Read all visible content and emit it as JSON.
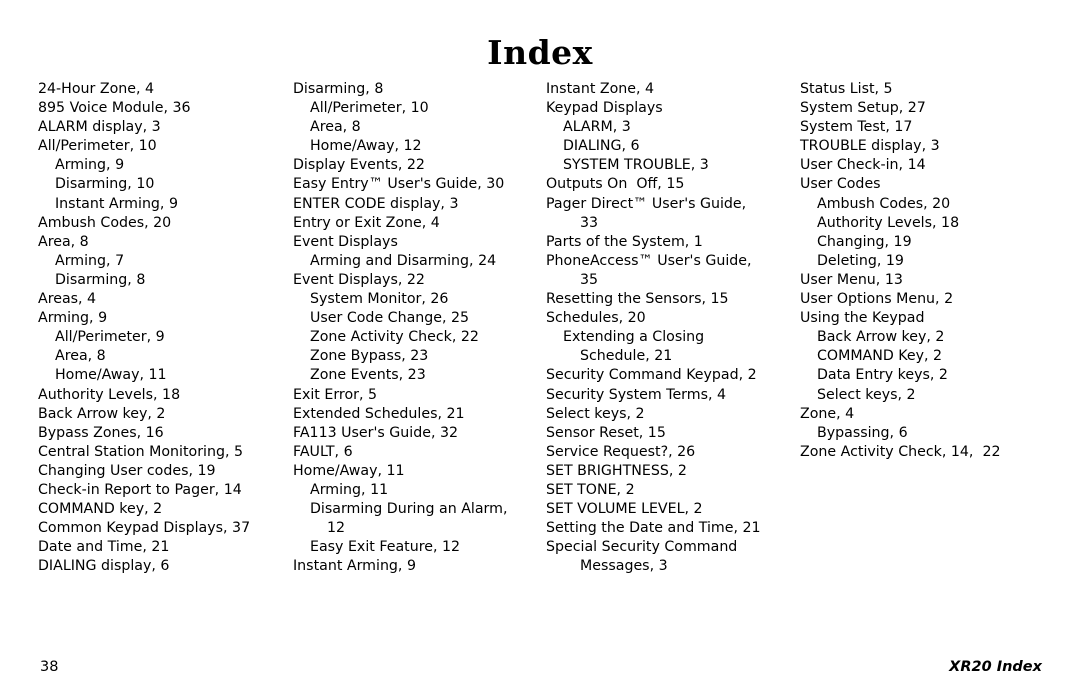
{
  "document": {
    "title": "Index",
    "footer_page_number": "38",
    "footer_running_head": "XR20 Index"
  },
  "columns": [
    {
      "id": "column-1",
      "entries": [
        {
          "text": "24-Hour Zone, 4",
          "level": 0
        },
        {
          "text": "895 Voice Module, 36",
          "level": 0
        },
        {
          "text": "ALARM display, 3",
          "level": 0
        },
        {
          "text": "All/Perimeter, 10",
          "level": 0
        },
        {
          "text": "Arming, 9",
          "level": 1
        },
        {
          "text": "Disarming, 10",
          "level": 1
        },
        {
          "text": "Instant Arming, 9",
          "level": 1
        },
        {
          "text": "Ambush Codes, 20",
          "level": 0
        },
        {
          "text": "Area, 8",
          "level": 0
        },
        {
          "text": "Arming, 7",
          "level": 1
        },
        {
          "text": "Disarming, 8",
          "level": 1
        },
        {
          "text": "Areas, 4",
          "level": 0
        },
        {
          "text": "Arming, 9",
          "level": 0
        },
        {
          "text": "All/Perimeter, 9",
          "level": 1
        },
        {
          "text": "Area, 8",
          "level": 1
        },
        {
          "text": "Home/Away, 11",
          "level": 1
        },
        {
          "text": "Authority Levels, 18",
          "level": 0
        },
        {
          "text": "Back Arrow key, 2",
          "level": 0
        },
        {
          "text": "Bypass Zones, 16",
          "level": 0
        },
        {
          "text": "Central Station Monitoring, 5",
          "level": 0
        },
        {
          "text": "Changing User codes, 19",
          "level": 0
        },
        {
          "text": "Check-in Report to Pager, 14",
          "level": 0
        },
        {
          "text": "COMMAND key, 2",
          "level": 0
        },
        {
          "text": "Common Keypad Displays, 37",
          "level": 0
        },
        {
          "text": "Date and Time, 21",
          "level": 0
        },
        {
          "text": "DIALING display, 6",
          "level": 0
        }
      ]
    },
    {
      "id": "column-2",
      "entries": [
        {
          "text": "Disarming, 8",
          "level": 0
        },
        {
          "text": "All/Perimeter, 10",
          "level": 1
        },
        {
          "text": "Area, 8",
          "level": 1
        },
        {
          "text": "Home/Away, 12",
          "level": 1
        },
        {
          "text": "Display Events, 22",
          "level": 0
        },
        {
          "text": "Easy Entry™ User's Guide, 30",
          "level": 0
        },
        {
          "text": "ENTER CODE display, 3",
          "level": 0
        },
        {
          "text": "Entry or Exit Zone, 4",
          "level": 0
        },
        {
          "text": "Event Displays",
          "level": 0
        },
        {
          "text": "Arming and Disarming, 24",
          "level": 1
        },
        {
          "text": "Event Displays, 22",
          "level": 0
        },
        {
          "text": "System Monitor, 26",
          "level": 1
        },
        {
          "text": "User Code Change, 25",
          "level": 1
        },
        {
          "text": "Zone Activity Check, 22",
          "level": 1
        },
        {
          "text": "Zone Bypass, 23",
          "level": 1
        },
        {
          "text": "Zone Events, 23",
          "level": 1
        },
        {
          "text": "Exit Error, 5",
          "level": 0
        },
        {
          "text": "Extended Schedules, 21",
          "level": 0
        },
        {
          "text": "FA113 User's Guide, 32",
          "level": 0
        },
        {
          "text": "FAULT, 6",
          "level": 0
        },
        {
          "text": "Home/Away, 11",
          "level": 0
        },
        {
          "text": "Arming, 11",
          "level": 1
        },
        {
          "text": "Disarming During an Alarm,",
          "level": 1
        },
        {
          "text": "12",
          "level": 2
        },
        {
          "text": "Easy Exit Feature, 12",
          "level": 1
        },
        {
          "text": "Instant Arming, 9",
          "level": 0
        }
      ]
    },
    {
      "id": "column-3",
      "entries": [
        {
          "text": "Instant Zone, 4",
          "level": 0
        },
        {
          "text": "Keypad Displays",
          "level": 0
        },
        {
          "text": "ALARM, 3",
          "level": 1
        },
        {
          "text": "DIALING, 6",
          "level": 1
        },
        {
          "text": "SYSTEM TROUBLE, 3",
          "level": 1
        },
        {
          "text": "Outputs On  Off, 15",
          "level": 0
        },
        {
          "text": "Pager Direct™ User's Guide,",
          "level": 0
        },
        {
          "text": "33",
          "level": 2
        },
        {
          "text": "Parts of the System, 1",
          "level": 0
        },
        {
          "text": "PhoneAccess™ User's Guide,",
          "level": 0
        },
        {
          "text": "35",
          "level": 2
        },
        {
          "text": "Resetting the Sensors, 15",
          "level": 0
        },
        {
          "text": "Schedules, 20",
          "level": 0
        },
        {
          "text": "Extending a Closing",
          "level": 1
        },
        {
          "text": "Schedule, 21",
          "level": 2
        },
        {
          "text": "Security Command Keypad, 2",
          "level": 0
        },
        {
          "text": "Security System Terms, 4",
          "level": 0
        },
        {
          "text": "Select keys, 2",
          "level": 0
        },
        {
          "text": "Sensor Reset, 15",
          "level": 0
        },
        {
          "text": "Service Request?, 26",
          "level": 0
        },
        {
          "text": "SET BRIGHTNESS, 2",
          "level": 0
        },
        {
          "text": "SET TONE, 2",
          "level": 0
        },
        {
          "text": "SET VOLUME LEVEL, 2",
          "level": 0
        },
        {
          "text": "Setting the Date and Time, 21",
          "level": 0
        },
        {
          "text": "Special Security Command",
          "level": 0
        },
        {
          "text": "Messages, 3",
          "level": 2
        }
      ]
    },
    {
      "id": "column-4",
      "entries": [
        {
          "text": "Status List, 5",
          "level": 0
        },
        {
          "text": "System Setup, 27",
          "level": 0
        },
        {
          "text": "System Test, 17",
          "level": 0
        },
        {
          "text": "TROUBLE display, 3",
          "level": 0
        },
        {
          "text": "User Check-in, 14",
          "level": 0
        },
        {
          "text": "User Codes",
          "level": 0
        },
        {
          "text": "Ambush Codes, 20",
          "level": 1
        },
        {
          "text": "Authority Levels, 18",
          "level": 1
        },
        {
          "text": "Changing, 19",
          "level": 1
        },
        {
          "text": "Deleting, 19",
          "level": 1
        },
        {
          "text": "User Menu, 13",
          "level": 0
        },
        {
          "text": "User Options Menu, 2",
          "level": 0
        },
        {
          "text": "Using the Keypad",
          "level": 0
        },
        {
          "text": "Back Arrow key, 2",
          "level": 1
        },
        {
          "text": "COMMAND Key, 2",
          "level": 1
        },
        {
          "text": "Data Entry keys, 2",
          "level": 1
        },
        {
          "text": "Select keys, 2",
          "level": 1
        },
        {
          "text": "Zone, 4",
          "level": 0
        },
        {
          "text": "Bypassing, 6",
          "level": 1
        },
        {
          "text": "Zone Activity Check, 14,  22",
          "level": 0
        }
      ]
    }
  ]
}
